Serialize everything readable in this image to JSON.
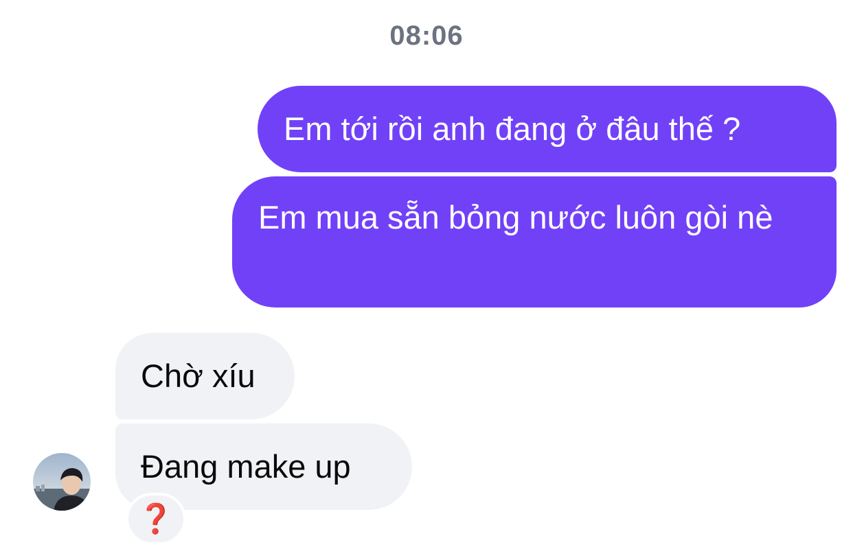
{
  "conversation": {
    "timestamp": "08:06",
    "outgoing": [
      {
        "text": "Em tới rồi anh đang ở đâu thế ?"
      },
      {
        "text": "Em mua sẵn bỏng nước luôn gòi nè"
      }
    ],
    "incoming": [
      {
        "text": "Chờ xíu"
      },
      {
        "text": "Đang make up"
      }
    ],
    "reaction": {
      "emoji": "❓",
      "icon": "question-mark-icon"
    }
  },
  "colors": {
    "outgoing_bubble": "#7141f8",
    "incoming_bubble": "#f1f2f5",
    "timestamp_text": "#6b7280",
    "reaction_glyph": "#e3151e"
  }
}
